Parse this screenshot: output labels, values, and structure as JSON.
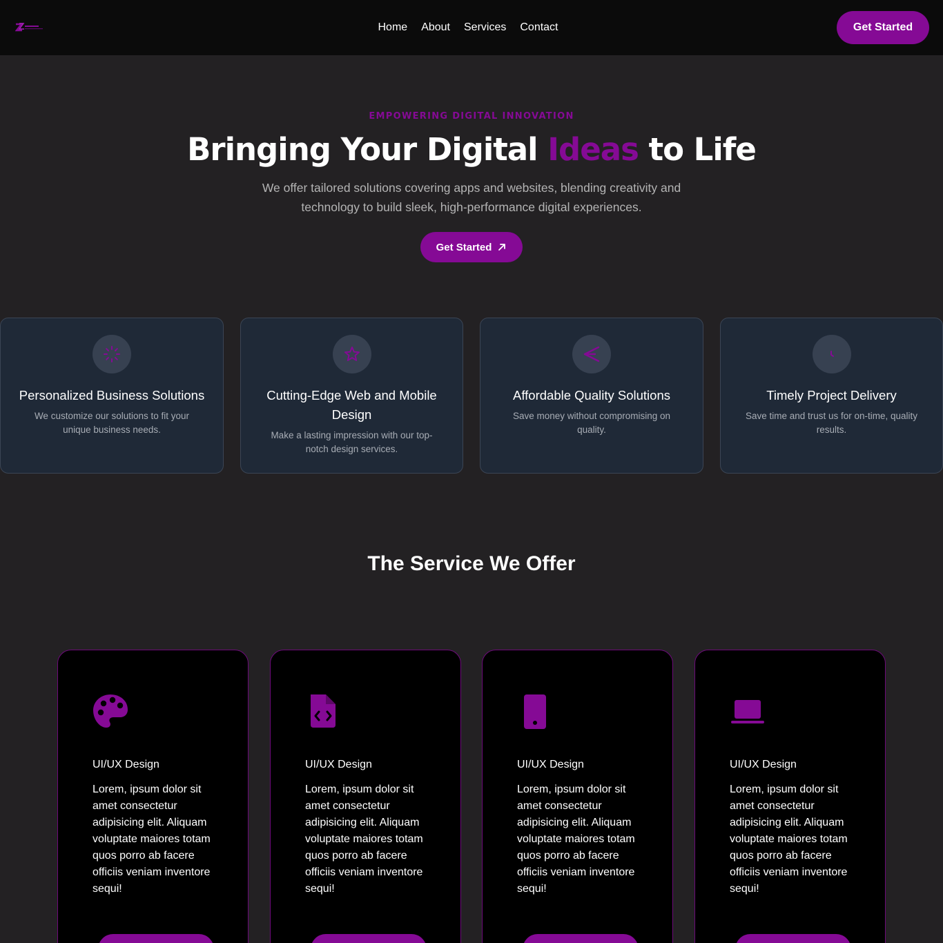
{
  "colors": {
    "accent": "#850a95",
    "background": "#232123",
    "nav": "#0b0b0b",
    "card": "#1f2937"
  },
  "nav": {
    "logo_icon": "brand-logo-icon",
    "links": [
      "Home",
      "About",
      "Services",
      "Contact"
    ],
    "cta": "Get Started"
  },
  "hero": {
    "eyebrow": "EMPOWERING DIGITAL INNOVATION",
    "title_pre": "Bringing Your Digital ",
    "title_accent": "Ideas",
    "title_post": " to Life",
    "subtitle": "We offer tailored solutions covering apps and websites, blending creativity and technology to build sleek, high-performance digital experiences.",
    "cta": "Get Started",
    "cta_icon": "arrow-up-right-icon"
  },
  "features": [
    {
      "icon": "spinner-icon",
      "title": "Personalized Business Solutions",
      "desc": "We customize our solutions to fit your unique business needs."
    },
    {
      "icon": "star-icon",
      "title": "Cutting-Edge Web and Mobile Design",
      "desc": "Make a lasting impression with our top-notch design services."
    },
    {
      "icon": "send-icon",
      "title": "Affordable Quality Solutions",
      "desc": "Save money without compromising on quality."
    },
    {
      "icon": "clock-icon",
      "title": "Timely Project Delivery",
      "desc": "Save time and trust us for on-time, quality results."
    }
  ],
  "services": {
    "title": "The Service We Offer",
    "cards": [
      {
        "icon": "palette-icon",
        "name": "UI/UX Design",
        "desc": "Lorem, ipsum dolor sit amet consectetur adipisicing elit. Aliquam voluptate maiores totam quos porro ab facere officiis veniam inventore sequi!"
      },
      {
        "icon": "file-code-icon",
        "name": "UI/UX Design",
        "desc": "Lorem, ipsum dolor sit amet consectetur adipisicing elit. Aliquam voluptate maiores totam quos porro ab facere officiis veniam inventore sequi!"
      },
      {
        "icon": "mobile-icon",
        "name": "UI/UX Design",
        "desc": "Lorem, ipsum dolor sit amet consectetur adipisicing elit. Aliquam voluptate maiores totam quos porro ab facere officiis veniam inventore sequi!"
      },
      {
        "icon": "laptop-icon",
        "name": "UI/UX Design",
        "desc": "Lorem, ipsum dolor sit amet consectetur adipisicing elit. Aliquam voluptate maiores totam quos porro ab facere officiis veniam inventore sequi!"
      }
    ]
  }
}
